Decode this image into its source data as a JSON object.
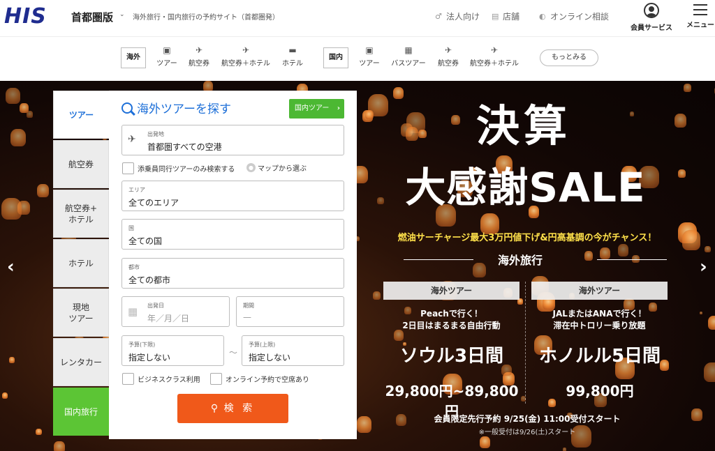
{
  "header": {
    "logo": "HIS",
    "region": "首都圏版",
    "tagline": "海外旅行・国内旅行の予約サイト（首都圏発）",
    "links": [
      {
        "label": "法人向け",
        "icon": "corporate-icon"
      },
      {
        "label": "店舗",
        "icon": "store-icon"
      },
      {
        "label": "オンライン相談",
        "icon": "consult-icon"
      }
    ],
    "member_label": "会員サービス",
    "menu_label": "メニュー"
  },
  "categories": {
    "overseas_label": "海外",
    "overseas": [
      {
        "label": "ツアー",
        "icon": "suitcase-icon"
      },
      {
        "label": "航空券",
        "icon": "airplane-icon"
      },
      {
        "label": "航空券＋ホテル",
        "icon": "flight-hotel-icon"
      },
      {
        "label": "ホテル",
        "icon": "bed-icon"
      }
    ],
    "domestic_label": "国内",
    "domestic": [
      {
        "label": "ツアー",
        "icon": "suitcase-icon"
      },
      {
        "label": "バスツアー",
        "icon": "bus-icon"
      },
      {
        "label": "航空券",
        "icon": "airplane-icon"
      },
      {
        "label": "航空券＋ホテル",
        "icon": "flight-hotel-icon"
      }
    ],
    "more": "もっとみる"
  },
  "side_tabs": [
    "ツアー",
    "航空券",
    "航空券+\nホテル",
    "ホテル",
    "現地\nツアー",
    "レンタカー",
    "国内旅行"
  ],
  "search": {
    "title": "海外ツアーを探す",
    "domestic_button": "国内ツアー",
    "departure": {
      "label": "出発地",
      "value": "首都圏すべての空港"
    },
    "escort_only": "添乗員同行ツアーのみ検索する",
    "map_link": "マップから選ぶ",
    "area": {
      "label": "エリア",
      "value": "全てのエリア"
    },
    "country": {
      "label": "国",
      "value": "全ての国"
    },
    "city": {
      "label": "都市",
      "value": "全ての都市"
    },
    "date": {
      "label": "出発日",
      "placeholder": "年／月／日"
    },
    "period": {
      "label": "期間",
      "placeholder": "—"
    },
    "budget_min": {
      "label": "予算(下限)",
      "value": "指定しない"
    },
    "budget_max": {
      "label": "予算(上限)",
      "value": "指定しない"
    },
    "business_class": "ビジネスクラス利用",
    "online_available": "オンライン予約で空席あり",
    "submit": "検 索"
  },
  "promo": {
    "title_line1": "決算",
    "title_line2": "大感謝SALE",
    "subtitle": "燃油サーチャージ最大3万円値下げ&円高基調の今がチャンス！",
    "category": "海外旅行",
    "deals": [
      {
        "head": "海外ツアー",
        "desc1": "Peachで行く！",
        "desc2": "2日目はまるまる自由行動",
        "dest": "ソウル3日間",
        "price": "29,800円~89,800円"
      },
      {
        "head": "海外ツアー",
        "desc1": "JALまたはANAで行く！",
        "desc2": "滞在中トロリー乗り放題",
        "dest": "ホノルル5日間",
        "price": "99,800円"
      }
    ],
    "note": "会員限定先行予約 9/25(金) 11:00受付スタート",
    "note2": "※一般受付は9/26(土)スタート"
  },
  "colors": {
    "brand": "#1f2c8f",
    "accent_blue": "#1d6fd8",
    "domestic_green": "#5cc535",
    "search_orange": "#f0591a"
  }
}
